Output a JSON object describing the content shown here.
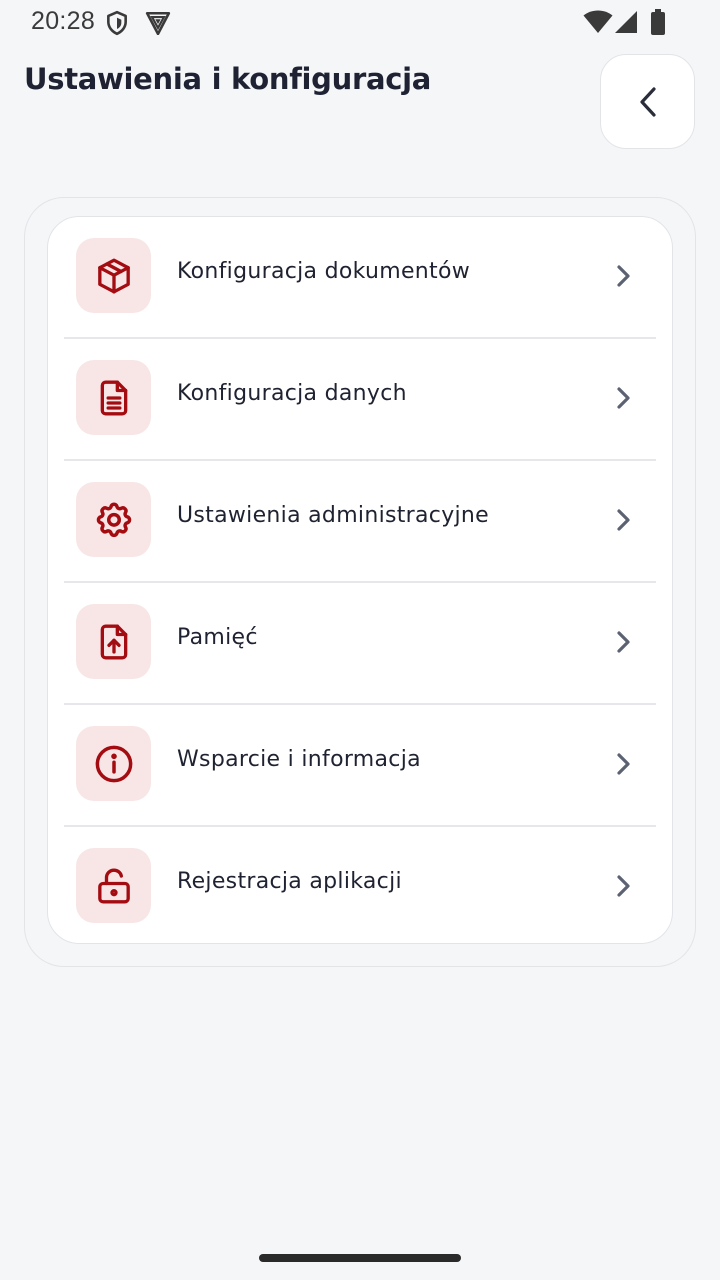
{
  "status_bar": {
    "time": "20:28"
  },
  "header": {
    "title": "Ustawienia i konfiguracja"
  },
  "menu": {
    "items": [
      {
        "label": "Konfiguracja dokumentów",
        "icon": "box-icon"
      },
      {
        "label": "Konfiguracja danych",
        "icon": "document-icon"
      },
      {
        "label": "Ustawienia administracyjne",
        "icon": "gear-icon"
      },
      {
        "label": "Pamięć",
        "icon": "file-upload-icon"
      },
      {
        "label": "Wsparcie i informacja",
        "icon": "info-icon"
      },
      {
        "label": "Rejestracja aplikacji",
        "icon": "unlock-icon"
      }
    ]
  },
  "colors": {
    "accent": "#a30d12",
    "icon_background": "#f8e6e7",
    "background": "#f5f6f8",
    "chevron": "#5b6272"
  }
}
